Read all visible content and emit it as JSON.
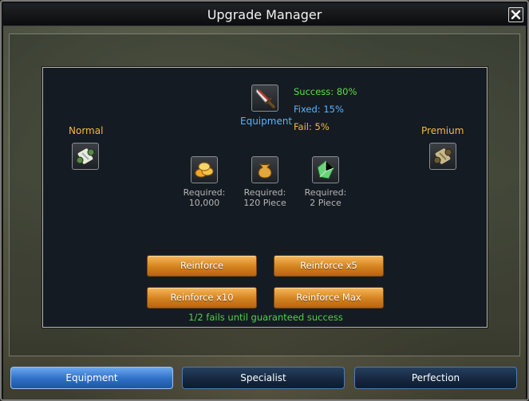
{
  "window": {
    "title": "Upgrade Manager"
  },
  "panel": {
    "normal_label": "Normal",
    "premium_label": "Premium",
    "equipment_label": "Equipment",
    "stats": {
      "success": "Success: 80%",
      "fixed": "Fixed: 15%",
      "fail": "Fail: 5%"
    },
    "requirements": [
      {
        "label": "Required:",
        "value": "10,000",
        "icon": "gold-coins-icon"
      },
      {
        "label": "Required:",
        "value": "120 Piece",
        "icon": "gold-pouch-icon"
      },
      {
        "label": "Required:",
        "value": "2 Piece",
        "icon": "green-gem-icon"
      }
    ],
    "buttons": {
      "reinforce": "Reinforce",
      "reinforce_x5": "Reinforce x5",
      "reinforce_x10": "Reinforce x10",
      "reinforce_max": "Reinforce Max"
    },
    "fails_text": "1/2 fails until guaranteed success"
  },
  "tabs": [
    {
      "label": "Equipment",
      "active": true
    },
    {
      "label": "Specialist",
      "active": false
    },
    {
      "label": "Perfection",
      "active": false
    }
  ],
  "colors": {
    "success": "#56e043",
    "fixed": "#58b4ff",
    "fail": "#f4b940",
    "button": "#d4821f",
    "tab_active": "#2f6fc4"
  }
}
